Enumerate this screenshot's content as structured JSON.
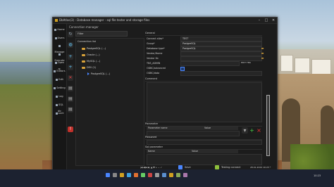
{
  "window": {
    "title": "DbAtlas(3) - Database manager - sql file tester and storage files",
    "subtitle": "Connection manager",
    "buttons": {
      "min": "–",
      "max": "□",
      "close": "✕"
    }
  },
  "nav": [
    {
      "label": "Home"
    },
    {
      "label": "Users"
    },
    {
      "label": "Manage"
    },
    {
      "label": "Execute"
    },
    {
      "label": "Open w."
    },
    {
      "label": "Editors"
    },
    {
      "label": "Edit"
    },
    {
      "label": "Setting"
    },
    {
      "label": "Log"
    },
    {
      "label": "SQL dic"
    },
    {
      "label": "Lock"
    }
  ],
  "toolbar_icons": [
    "refresh-icon",
    "globe-icon",
    "add-icon",
    "add-icon",
    "delete-icon",
    "doc-icon",
    "doc-icon",
    "doc-icon",
    "error-icon"
  ],
  "filter": {
    "label": "Filter"
  },
  "tree": {
    "header": "Connection list",
    "nodes": [
      {
        "label": "PostgreSQL (...)",
        "type": "folder",
        "level": 1
      },
      {
        "label": "Oracle (...)",
        "type": "folder",
        "level": 1
      },
      {
        "label": "MySQL (...)",
        "type": "folder",
        "level": 1
      },
      {
        "label": "DEV (1)",
        "type": "folder",
        "level": 1
      },
      {
        "label": "PostgreSQL (...)",
        "type": "db",
        "level": 2
      }
    ]
  },
  "general": {
    "section": "General",
    "fields": [
      {
        "label": "Connect alias*",
        "value": "TEST"
      },
      {
        "label": "Group*",
        "value": "PostgreSQL"
      },
      {
        "label": "Database type*",
        "value": "PostgreSQL"
      },
      {
        "label": "Vendor/Home",
        "value": ""
      },
      {
        "label": "Vendor lib",
        "value": ""
      },
      {
        "label": "TNS_ADMIN",
        "value": ""
      },
      {
        "label": "ODBC/advanced",
        "value": ""
      },
      {
        "label": "ODBC/data",
        "value": ""
      }
    ],
    "edit_tns": "EDIT TNS"
  },
  "comment": {
    "section": "Comment"
  },
  "parameter": {
    "section": "Parameter",
    "columns": [
      "Parameter name",
      "Value"
    ]
  },
  "password": {
    "section": "Password"
  },
  "sql_parameter": {
    "section": "Sql parameter",
    "columns": [
      "Name",
      "Value"
    ]
  },
  "footer": {
    "save": "Save",
    "test": "Testing connect",
    "status": "28.01.2024 10:23 *"
  },
  "taskbar": {
    "clock": "10:23"
  }
}
